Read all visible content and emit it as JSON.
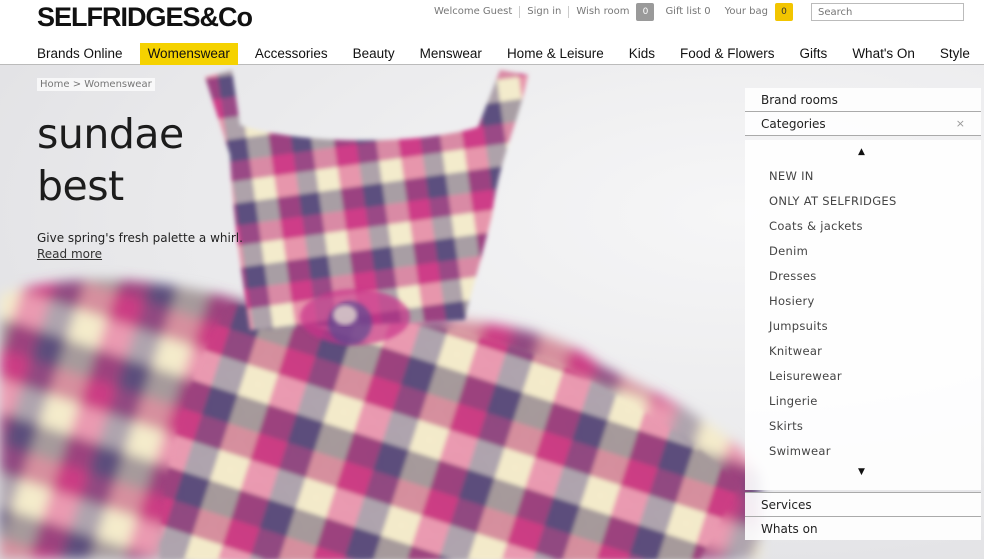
{
  "logo": "SELFRIDGES&Co",
  "utility": {
    "welcome": "Welcome Guest",
    "sign_in": "Sign in",
    "wish_room": "Wish room",
    "wish_count": "0",
    "gift_list": "Gift list 0",
    "your_bag": "Your bag",
    "bag_count": "0",
    "search_placeholder": "Search"
  },
  "nav": [
    "Brands Online",
    "Womenswear",
    "Accessories",
    "Beauty",
    "Menswear",
    "Home & Leisure",
    "Kids",
    "Food & Flowers",
    "Gifts",
    "What's On",
    "Style"
  ],
  "nav_active": "Womenswear",
  "breadcrumb": "Home > Womenswear",
  "headline": {
    "line1": "sundae",
    "line2": "best"
  },
  "tagline": "Give spring's fresh palette a whirl.",
  "read_more": "Read more",
  "sidebar": {
    "brand_rooms": "Brand rooms",
    "categories": "Categories",
    "close": "×",
    "up_arrow": "▲",
    "down_arrow": "▼",
    "items": [
      "NEW IN",
      "ONLY AT SELFRIDGES",
      "Coats & jackets",
      "Denim",
      "Dresses",
      "Hosiery",
      "Jumpsuits",
      "Knitwear",
      "Leisurewear",
      "Lingerie",
      "Skirts",
      "Swimwear"
    ],
    "services": "Services",
    "whats_on": "Whats on"
  },
  "colors": {
    "accent": "#f5d200",
    "plaid_pink": "#d9348c",
    "plaid_purple": "#4b3a8a",
    "plaid_yellow": "#e6c640"
  }
}
